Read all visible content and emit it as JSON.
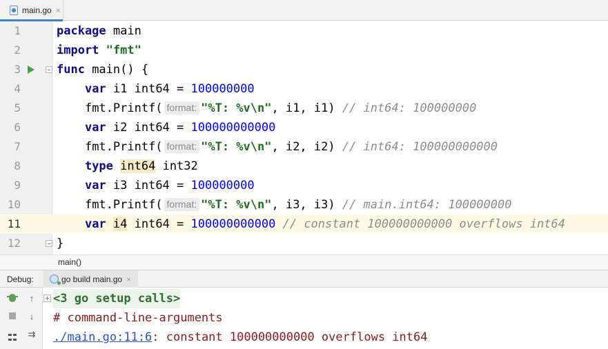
{
  "tabs": [
    {
      "label": "main.go",
      "icon": "go-file-icon",
      "close": "×"
    }
  ],
  "editor": {
    "lines": [
      {
        "num": "1"
      },
      {
        "num": "2"
      },
      {
        "num": "3"
      },
      {
        "num": "4"
      },
      {
        "num": "5"
      },
      {
        "num": "6"
      },
      {
        "num": "7"
      },
      {
        "num": "8"
      },
      {
        "num": "9"
      },
      {
        "num": "10"
      },
      {
        "num": "11"
      },
      {
        "num": "12"
      }
    ],
    "code": {
      "l1": {
        "kw": "package",
        "rest": " main"
      },
      "l2": {
        "kw": "import",
        "str": "\"fmt\""
      },
      "l3": {
        "kw": "func",
        "rest": " main() {"
      },
      "l4": {
        "kw": "var",
        "rest": " i1 int64 = ",
        "num": "100000000"
      },
      "l5": {
        "call": "fmt.Printf(",
        "hint": "format:",
        "str": "\"%T: %v\\n\"",
        "rest": ", i1, i1) ",
        "cmt": "// int64: 100000000"
      },
      "l6": {
        "kw": "var",
        "rest": " i2 int64 = ",
        "num": "100000000000"
      },
      "l7": {
        "call": "fmt.Printf(",
        "hint": "format:",
        "str": "\"%T: %v\\n\"",
        "rest": ", i2, i2) ",
        "cmt": "// int64: 100000000000"
      },
      "l8": {
        "kw": "type",
        "hl": "int64",
        "rest": " int32"
      },
      "l9": {
        "kw": "var",
        "rest": " i3 int64 = ",
        "num": "100000000"
      },
      "l10": {
        "call": "fmt.Printf(",
        "hint": "format:",
        "str": "\"%T: %v\\n\"",
        "rest": ", i3, i3) ",
        "cmt": "// main.int64: 100000000"
      },
      "l11": {
        "kw": "var",
        "hl": "i4",
        "rest": " int64 = ",
        "num": "100000000000",
        "cmt": "// constant 100000000000 overflows int64"
      },
      "l12": {
        "rest": "}"
      }
    },
    "current_line": "11"
  },
  "breadcrumb": "main()",
  "debug": {
    "label": "Debug:",
    "tab_label": "go build main.go",
    "tab_close": "×"
  },
  "console": {
    "toolbar": [
      {
        "icon": "debug-bug-icon"
      },
      {
        "icon": "stop-icon"
      },
      {
        "icon": "layout-icon"
      },
      {
        "icon": "up-arrow-icon",
        "glyph": "↑"
      },
      {
        "icon": "down-arrow-icon",
        "glyph": "↓"
      },
      {
        "icon": "soft-wrap-icon",
        "glyph": "⇉"
      }
    ],
    "setup_calls": "<3 go setup calls>",
    "line2": "# command-line-arguments",
    "err_link": "./main.go:11:6",
    "err_msg": ": constant 100000000000 overflows int64"
  },
  "colors": {
    "keyword": "#0b0b8b",
    "number": "#0000ff",
    "string": "#1f6e1f",
    "comment": "#8c8c8c",
    "error": "#8b1a1a",
    "link": "#2a4fd6",
    "current_line": "#fdfbe6",
    "tab_accent": "#4083c9"
  }
}
